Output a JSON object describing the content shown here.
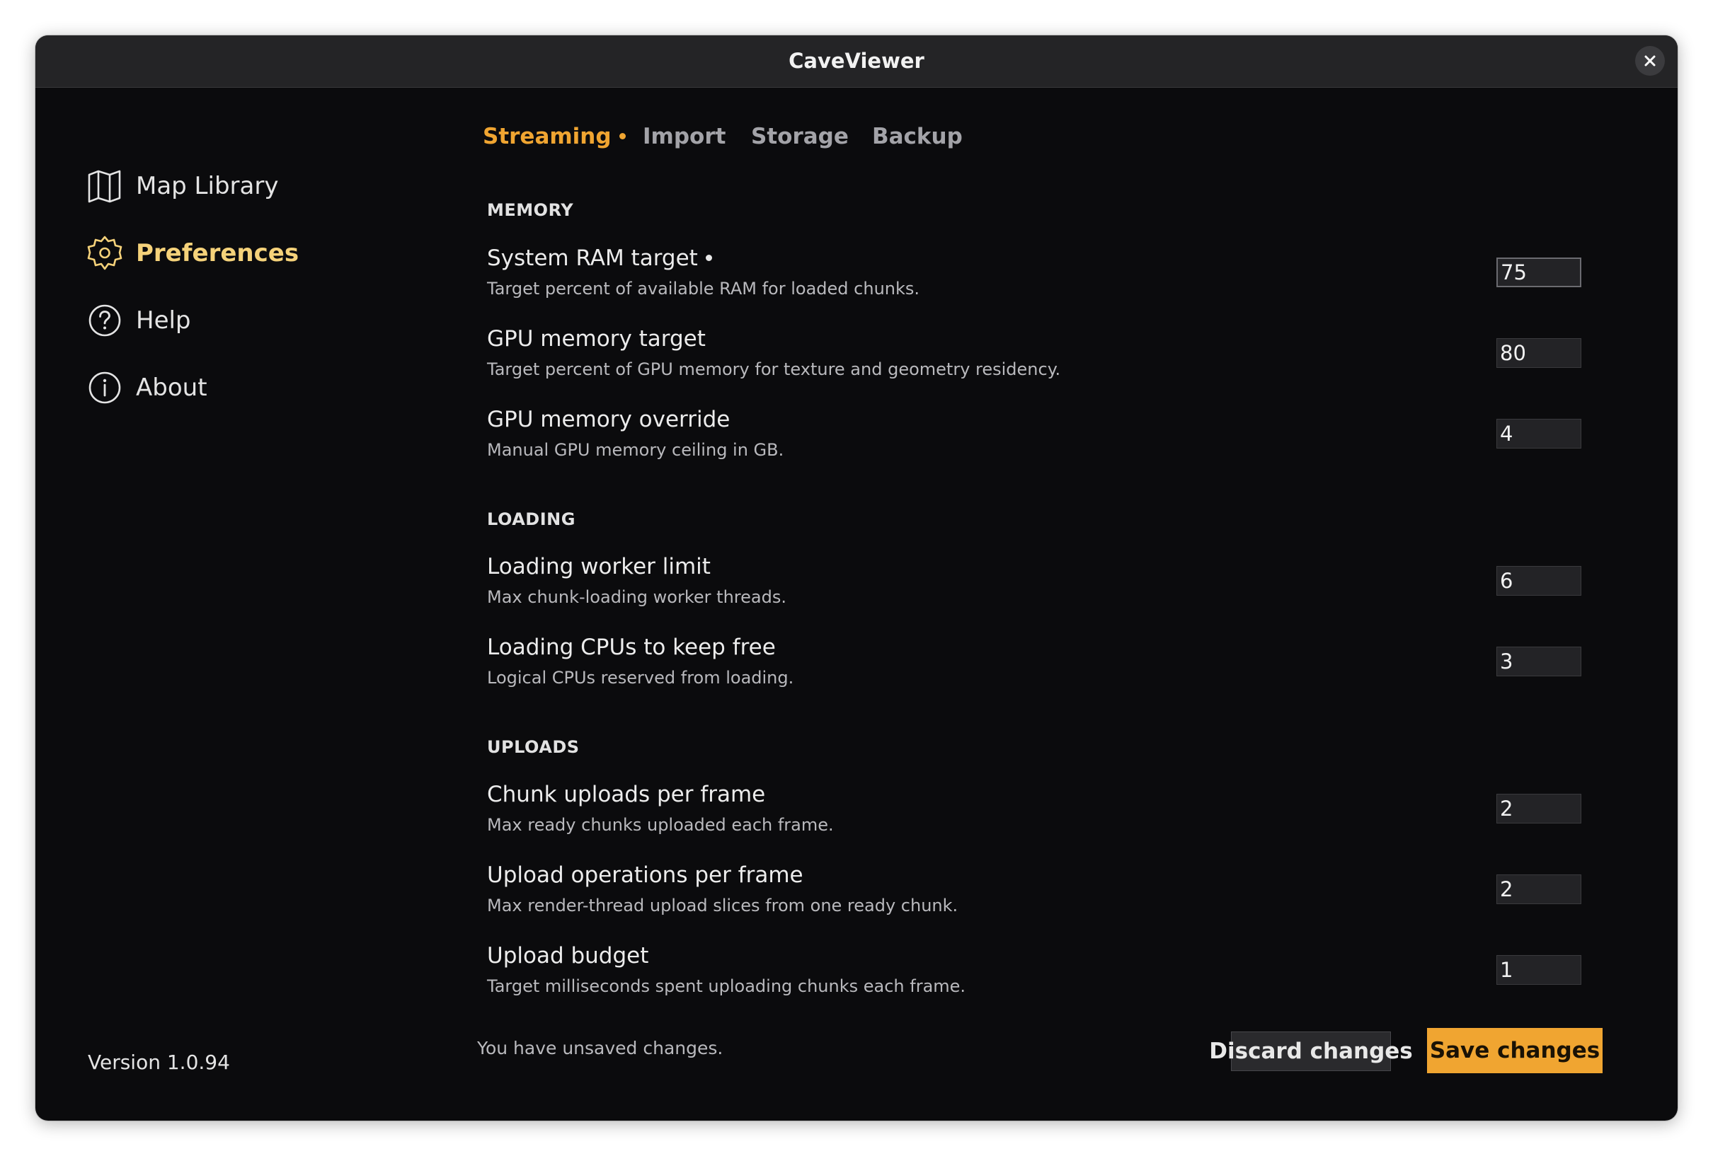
{
  "window": {
    "title": "CaveViewer"
  },
  "sidebar": {
    "items": [
      {
        "label": "Map Library",
        "icon": "map-icon"
      },
      {
        "label": "Preferences",
        "icon": "gear-icon",
        "active": true
      },
      {
        "label": "Help",
        "icon": "help-icon"
      },
      {
        "label": "About",
        "icon": "info-icon"
      }
    ],
    "version": "Version 1.0.94"
  },
  "tabs": [
    {
      "label": "Streaming",
      "active": true,
      "modified": true
    },
    {
      "label": "Import"
    },
    {
      "label": "Storage"
    },
    {
      "label": "Backup"
    }
  ],
  "sections": {
    "memory": {
      "heading": "MEMORY",
      "settings": [
        {
          "title": "System RAM target",
          "desc": "Target percent of available RAM for loaded chunks.",
          "value": "75",
          "modified": true
        },
        {
          "title": "GPU memory target",
          "desc": "Target percent of GPU memory for texture and geometry residency.",
          "value": "80"
        },
        {
          "title": "GPU memory override",
          "desc": "Manual GPU memory ceiling in GB.",
          "value": "4"
        }
      ]
    },
    "loading": {
      "heading": "LOADING",
      "settings": [
        {
          "title": "Loading worker limit",
          "desc": "Max chunk-loading worker threads.",
          "value": "6"
        },
        {
          "title": "Loading CPUs to keep free",
          "desc": "Logical CPUs reserved from loading.",
          "value": "3"
        }
      ]
    },
    "uploads": {
      "heading": "UPLOADS",
      "settings": [
        {
          "title": "Chunk uploads per frame",
          "desc": "Max ready chunks uploaded each frame.",
          "value": "2"
        },
        {
          "title": "Upload operations per frame",
          "desc": "Max render-thread upload slices from one ready chunk.",
          "value": "2"
        },
        {
          "title": "Upload budget",
          "desc": "Target milliseconds spent uploading chunks each frame.",
          "value": "1"
        }
      ]
    }
  },
  "footer": {
    "status": "You have unsaved changes.",
    "discard_label": "Discard changes",
    "save_label": "Save changes"
  },
  "colors": {
    "accent": "#f0a531",
    "active_nav": "#f5d27a",
    "background": "#0b0b0d",
    "titlebar": "#242426"
  }
}
